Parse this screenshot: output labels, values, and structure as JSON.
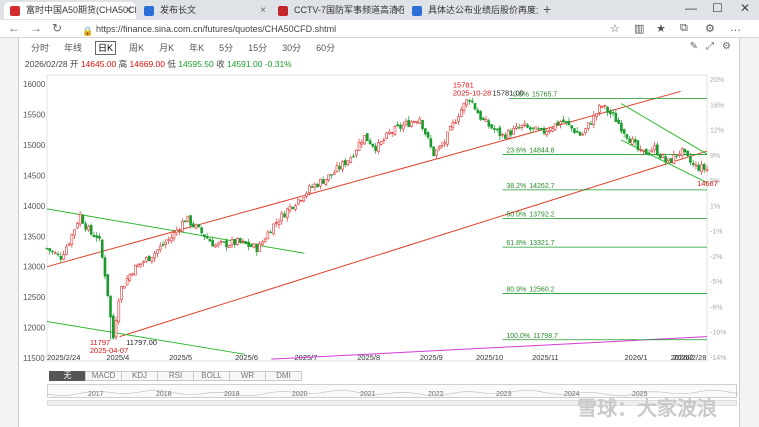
{
  "browser": {
    "tabs": [
      {
        "title": "富时中国A50期货(CHA50CFD)",
        "active": true,
        "color": "#d42c2c"
      },
      {
        "title": "发布长文",
        "active": false,
        "color": "#2b6fd6"
      },
      {
        "title": "CCTV-7国防军事频道高清在线直播",
        "active": false,
        "color": "#c2262b"
      },
      {
        "title": "具体达公布业绩后股价再度大跌",
        "active": false,
        "color": "#2b6fd6"
      }
    ],
    "new_tab": "+",
    "url": "https://finance.sina.com.cn/futures/quotes/CHA50CFD.shtml",
    "window_controls": [
      "—",
      "☐",
      "✕"
    ]
  },
  "toolbar": {
    "periods": [
      "分时",
      "年线",
      "日K",
      "周K",
      "月K",
      "年K",
      "5分",
      "15分",
      "30分",
      "60分"
    ],
    "active_period": "日K"
  },
  "quote": {
    "date": "2026/02/28",
    "open_label": "开",
    "open": "14645.00",
    "high_label": "高",
    "high": "14669.00",
    "low_label": "低",
    "low": "14595.50",
    "close_label": "收",
    "close": "14591.00",
    "change": "-0.31%"
  },
  "chart_data": {
    "type": "candlestick",
    "y_ticks": [
      16000,
      15500,
      15000,
      14500,
      14000,
      13500,
      13000,
      12500,
      12000,
      11500
    ],
    "ylim": [
      11450,
      16150
    ],
    "pct_ticks": [
      "20%",
      "16%",
      "12%",
      "9%",
      "5%",
      "1%",
      "-1%",
      "-2%",
      "-5%",
      "-6%",
      "-10%",
      "-14%"
    ],
    "x_ticks": [
      "2025/2/24",
      "2025/4",
      "2025/5",
      "2025/6",
      "2025/7",
      "2025/8",
      "2025/9",
      "2025/10",
      "2025/11",
      "2026/1",
      "2026/2",
      "2026/2/28"
    ],
    "close_path": [
      [
        0,
        13300
      ],
      [
        0.02,
        13150
      ],
      [
        0.035,
        13450
      ],
      [
        0.05,
        13850
      ],
      [
        0.065,
        13550
      ],
      [
        0.078,
        13500
      ],
      [
        0.09,
        12750
      ],
      [
        0.1,
        11800
      ],
      [
        0.11,
        12600
      ],
      [
        0.13,
        12950
      ],
      [
        0.16,
        13200
      ],
      [
        0.19,
        13500
      ],
      [
        0.21,
        13800
      ],
      [
        0.23,
        13600
      ],
      [
        0.255,
        13350
      ],
      [
        0.29,
        13400
      ],
      [
        0.32,
        13300
      ],
      [
        0.34,
        13650
      ],
      [
        0.37,
        14000
      ],
      [
        0.4,
        14300
      ],
      [
        0.43,
        14500
      ],
      [
        0.46,
        14800
      ],
      [
        0.48,
        15150
      ],
      [
        0.5,
        14950
      ],
      [
        0.52,
        15200
      ],
      [
        0.545,
        15350
      ],
      [
        0.565,
        15450
      ],
      [
        0.585,
        14850
      ],
      [
        0.6,
        15000
      ],
      [
        0.625,
        15550
      ],
      [
        0.64,
        15780
      ],
      [
        0.66,
        15400
      ],
      [
        0.69,
        15150
      ],
      [
        0.72,
        15300
      ],
      [
        0.75,
        15200
      ],
      [
        0.78,
        15400
      ],
      [
        0.81,
        15150
      ],
      [
        0.84,
        15650
      ],
      [
        0.86,
        15450
      ],
      [
        0.88,
        15150
      ],
      [
        0.9,
        14850
      ],
      [
        0.92,
        14950
      ],
      [
        0.94,
        14700
      ],
      [
        0.96,
        14900
      ],
      [
        0.98,
        14650
      ],
      [
        1,
        14600
      ]
    ],
    "annotations": {
      "high_label": "15781",
      "high_date": "2025-10-28",
      "high_value": "15781.00",
      "low_label": "11797",
      "low_date": "2025-04-07",
      "low_value": "11797.00",
      "last_price": "14667"
    },
    "fib_levels": [
      {
        "label": "0.0%",
        "value": 15765.7
      },
      {
        "label": "23.6%",
        "value": 14844.8
      },
      {
        "label": "38.2%",
        "value": 14262.7
      },
      {
        "label": "50.0%",
        "value": 13792.2
      },
      {
        "label": "61.8%",
        "value": 13321.7
      },
      {
        "label": "80.9%",
        "value": 12560.2
      },
      {
        "label": "100.0%",
        "value": 11798.7
      }
    ]
  },
  "indicator_tabs": [
    "无",
    "MACD",
    "KDJ",
    "RSI",
    "BOLL",
    "WR",
    "DMI"
  ],
  "active_indicator": "无",
  "navigator_years": [
    "2017",
    "2018",
    "2019",
    "2020",
    "2021",
    "2022",
    "2023",
    "2024",
    "2025"
  ],
  "watermark": "雪球：大家波浪",
  "colors": {
    "up": "#e03030",
    "down": "#1a9b2c",
    "channel": "#e0402a",
    "fib": "#1a9b2c",
    "axis": "#888888",
    "trend": "#d43ad6"
  }
}
